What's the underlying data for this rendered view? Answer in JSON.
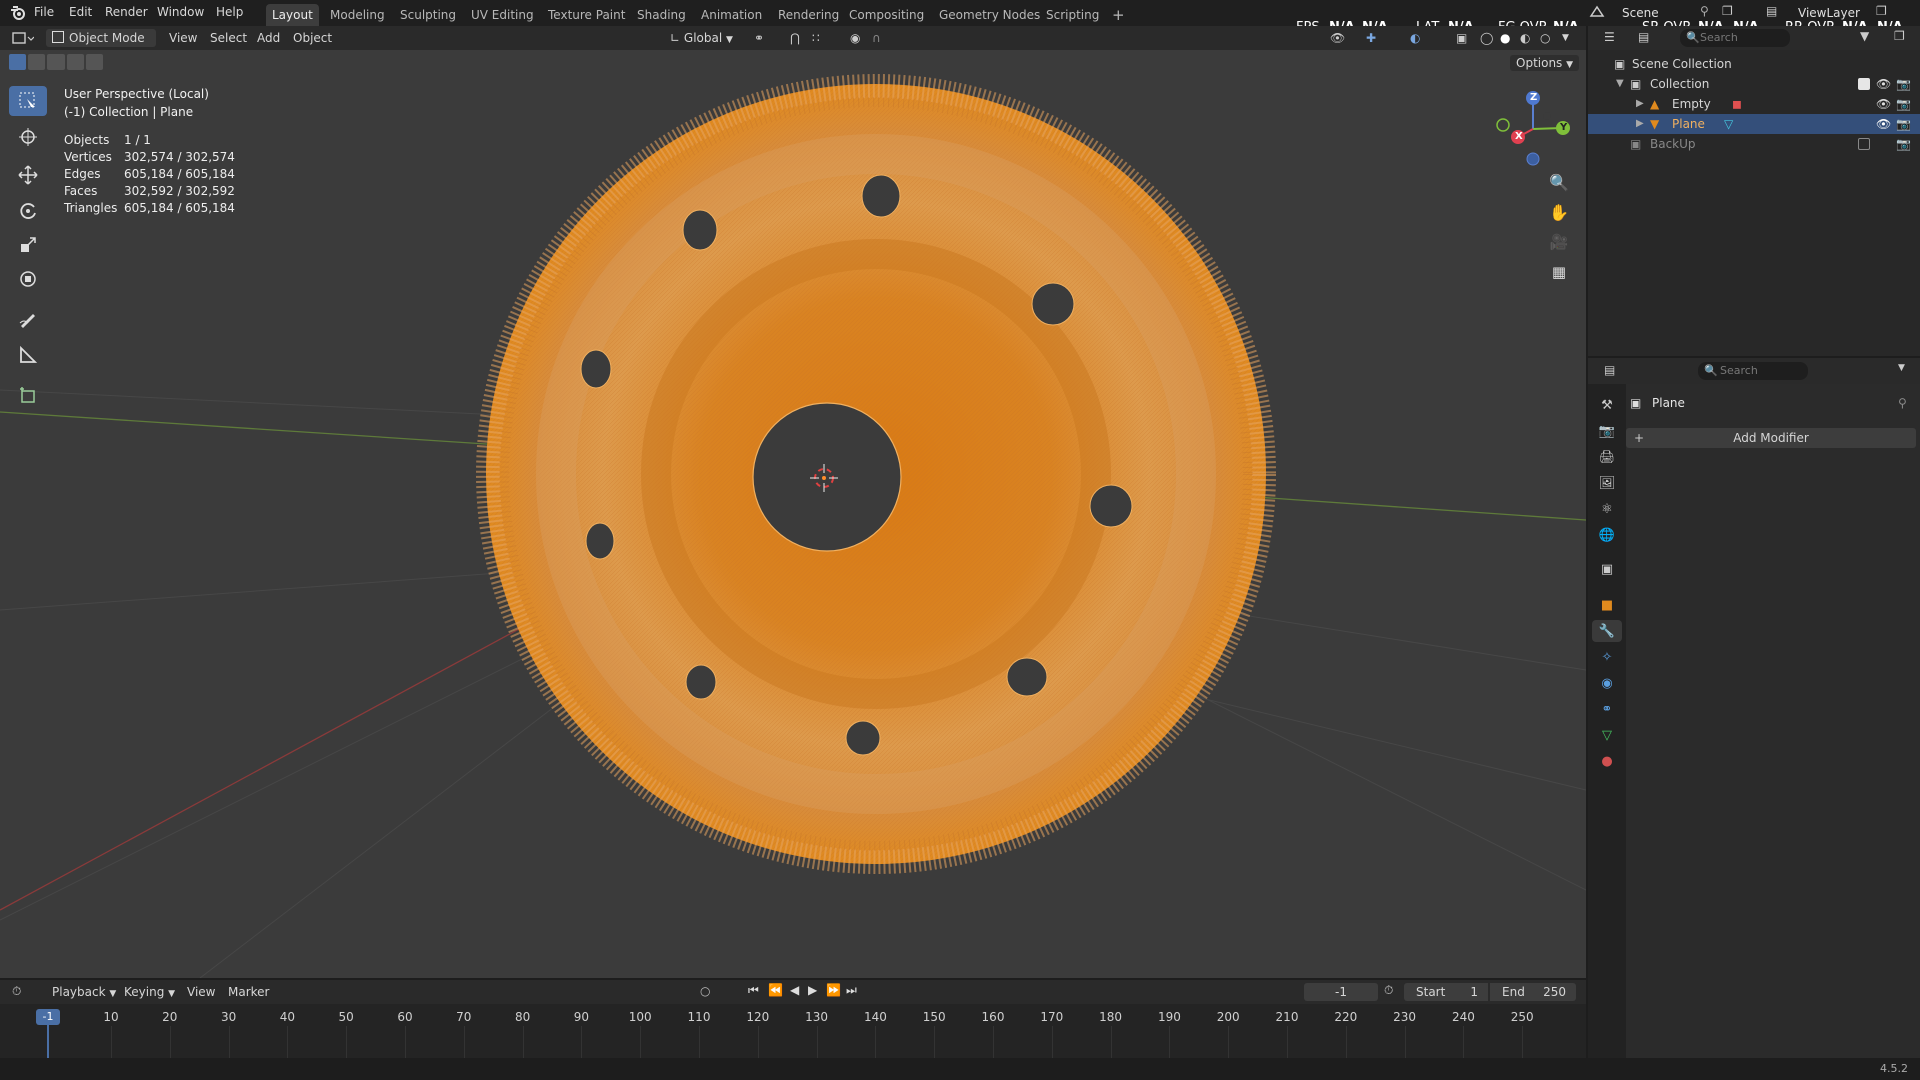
{
  "menu": [
    "File",
    "Edit",
    "Render",
    "Window",
    "Help"
  ],
  "workspaces": [
    "Layout",
    "Modeling",
    "Sculpting",
    "UV Editing",
    "Texture Paint",
    "Shading",
    "Animation",
    "Rendering",
    "Compositing",
    "Geometry Nodes",
    "Scripting"
  ],
  "active_workspace": "Layout",
  "plus": "+",
  "scene_name": "Scene",
  "view_layer": "ViewLayer",
  "overlays_stats": {
    "fps": "FPS",
    "fps_val": "N/A",
    "fps_val2": "N/A",
    "lat": "LAT",
    "lat_val": "N/A",
    "fg": "FG OVR",
    "fg_val": "N/A,",
    "sr": "SR OVR",
    "sr_val": "N/A,",
    "sr_val2": "N/A",
    "rr": "RR OVR",
    "rr_val": "N/A,",
    "rr_val2": "N/A"
  },
  "header": {
    "mode": "Object Mode",
    "view": "View",
    "select": "Select",
    "add": "Add",
    "object": "Object",
    "orientation": "Global",
    "options": "Options",
    "search_placeholder": "Search"
  },
  "viewport_info": {
    "perspective": "User Perspective (Local)",
    "collection": "(-1) Collection | Plane",
    "stats": [
      {
        "label": "Objects",
        "value": "1 / 1"
      },
      {
        "label": "Vertices",
        "value": "302,574 / 302,574"
      },
      {
        "label": "Edges",
        "value": "605,184 / 605,184"
      },
      {
        "label": "Faces",
        "value": "302,592 / 302,592"
      },
      {
        "label": "Triangles",
        "value": "605,184 / 605,184"
      }
    ]
  },
  "gizmo": {
    "z": "Z",
    "x": "X",
    "y": "Y"
  },
  "outliner": {
    "search_placeholder": "Search",
    "scene_collection": "Scene Collection",
    "collection": "Collection",
    "items": [
      "Empty",
      "Plane"
    ],
    "backup": "BackUp"
  },
  "properties": {
    "search_placeholder": "Search",
    "object_name": "Plane",
    "add_modifier": "Add Modifier"
  },
  "timeline": {
    "playback": "Playback",
    "keying": "Keying",
    "view": "View",
    "marker": "Marker",
    "current_frame": "-1",
    "start_label": "Start",
    "start": "1",
    "end_label": "End",
    "end": "250",
    "ticks": [
      "10",
      "20",
      "30",
      "40",
      "50",
      "60",
      "70",
      "80",
      "90",
      "100",
      "110",
      "120",
      "130",
      "140",
      "150",
      "160",
      "170",
      "180",
      "190",
      "200",
      "210",
      "220",
      "230",
      "240",
      "250"
    ]
  },
  "version": "4.5.2",
  "colors": {
    "accent": "#4a6fa5",
    "object_orange": "#e08a1e",
    "viewport_bg": "#3b3b3b"
  }
}
